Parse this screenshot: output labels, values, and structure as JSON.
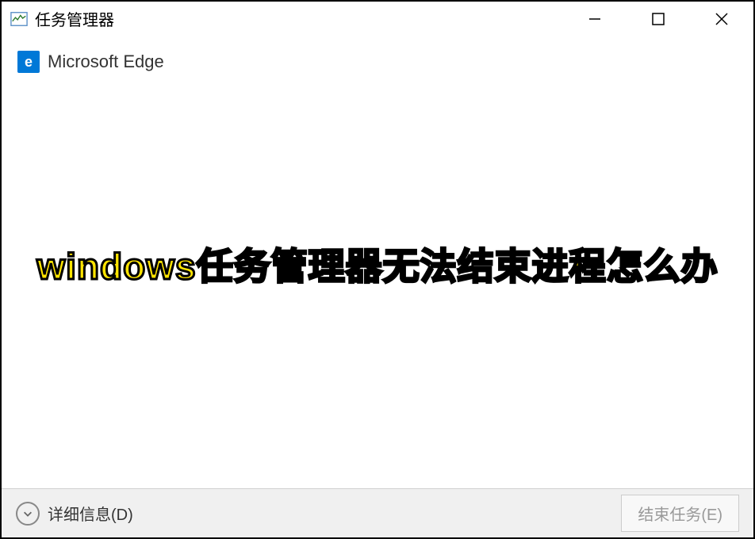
{
  "titlebar": {
    "title": "任务管理器"
  },
  "content": {
    "processes": [
      {
        "name": "Microsoft Edge",
        "icon_letter": "e"
      }
    ]
  },
  "overlay": {
    "text": "windows任务管理器无法结束进程怎么办"
  },
  "footer": {
    "details_label": "详细信息(D)",
    "end_task_label": "结束任务(E)"
  }
}
